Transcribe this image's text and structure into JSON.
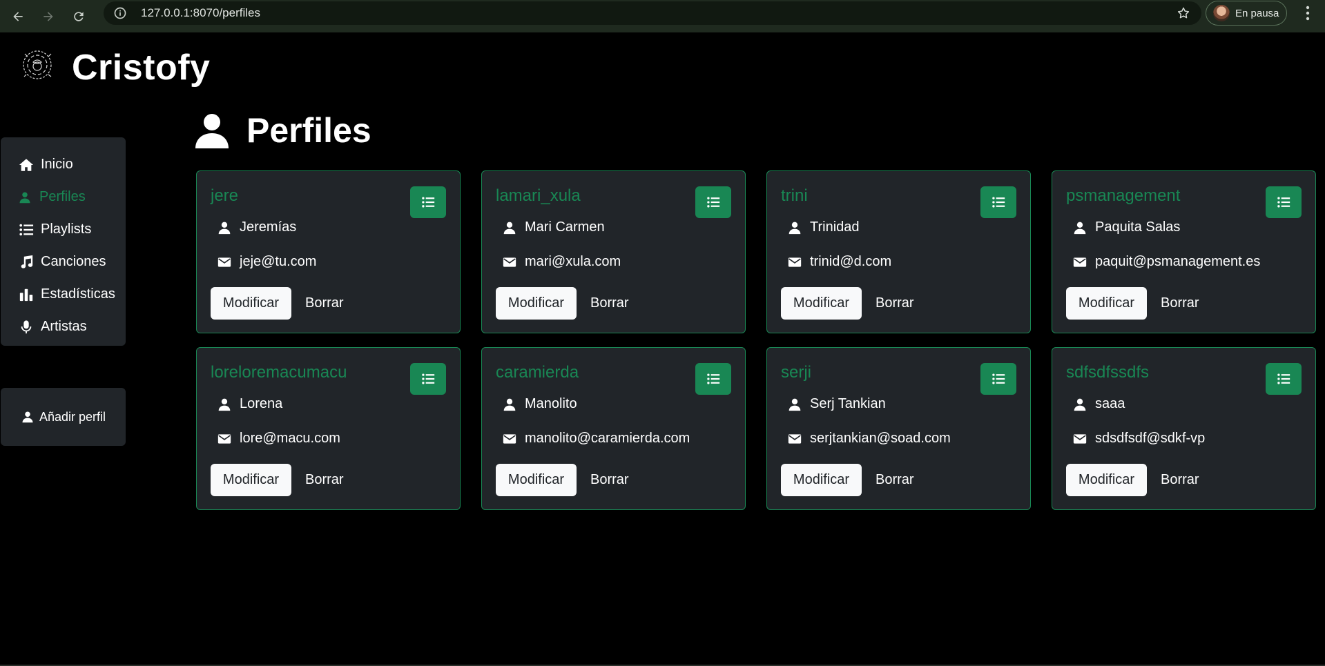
{
  "browser": {
    "url": "127.0.0.1:8070/perfiles",
    "profile_label": "En pausa"
  },
  "app": {
    "brand": "Cristofy"
  },
  "sidebar": {
    "items": [
      {
        "label": "Inicio",
        "icon": "home-icon"
      },
      {
        "label": "Perfiles",
        "icon": "user-icon",
        "active": true
      },
      {
        "label": "Playlists",
        "icon": "list-icon"
      },
      {
        "label": "Canciones",
        "icon": "music-icon"
      },
      {
        "label": "Estadísticas",
        "icon": "bar-chart-icon"
      },
      {
        "label": "Artistas",
        "icon": "microphone-icon"
      }
    ],
    "add_profile": "Añadir perfil"
  },
  "page": {
    "title": "Perfiles"
  },
  "profiles": [
    {
      "username": "jere",
      "name": "Jeremías",
      "email": "jeje@tu.com"
    },
    {
      "username": "lamari_xula",
      "name": "Mari Carmen",
      "email": "mari@xula.com"
    },
    {
      "username": "trini",
      "name": "Trinidad",
      "email": "trinid@d.com"
    },
    {
      "username": "psmanagement",
      "name": "Paquita Salas",
      "email": "paquit@psmanagement.es"
    },
    {
      "username": "loreloremacumacu",
      "name": "Lorena",
      "email": "lore@macu.com"
    },
    {
      "username": "caramierda",
      "name": "Manolito",
      "email": "manolito@caramierda.com"
    },
    {
      "username": "serji",
      "name": "Serj Tankian",
      "email": "serjtankian@soad.com"
    },
    {
      "username": "sdfsdfssdfs",
      "name": "saaa",
      "email": "sdsdfsdf@sdkf-vp"
    }
  ],
  "actions": {
    "modify": "Modificar",
    "delete": "Borrar"
  },
  "colors": {
    "accent": "#198754",
    "card_bg": "#212529",
    "page_bg": "#000000"
  }
}
